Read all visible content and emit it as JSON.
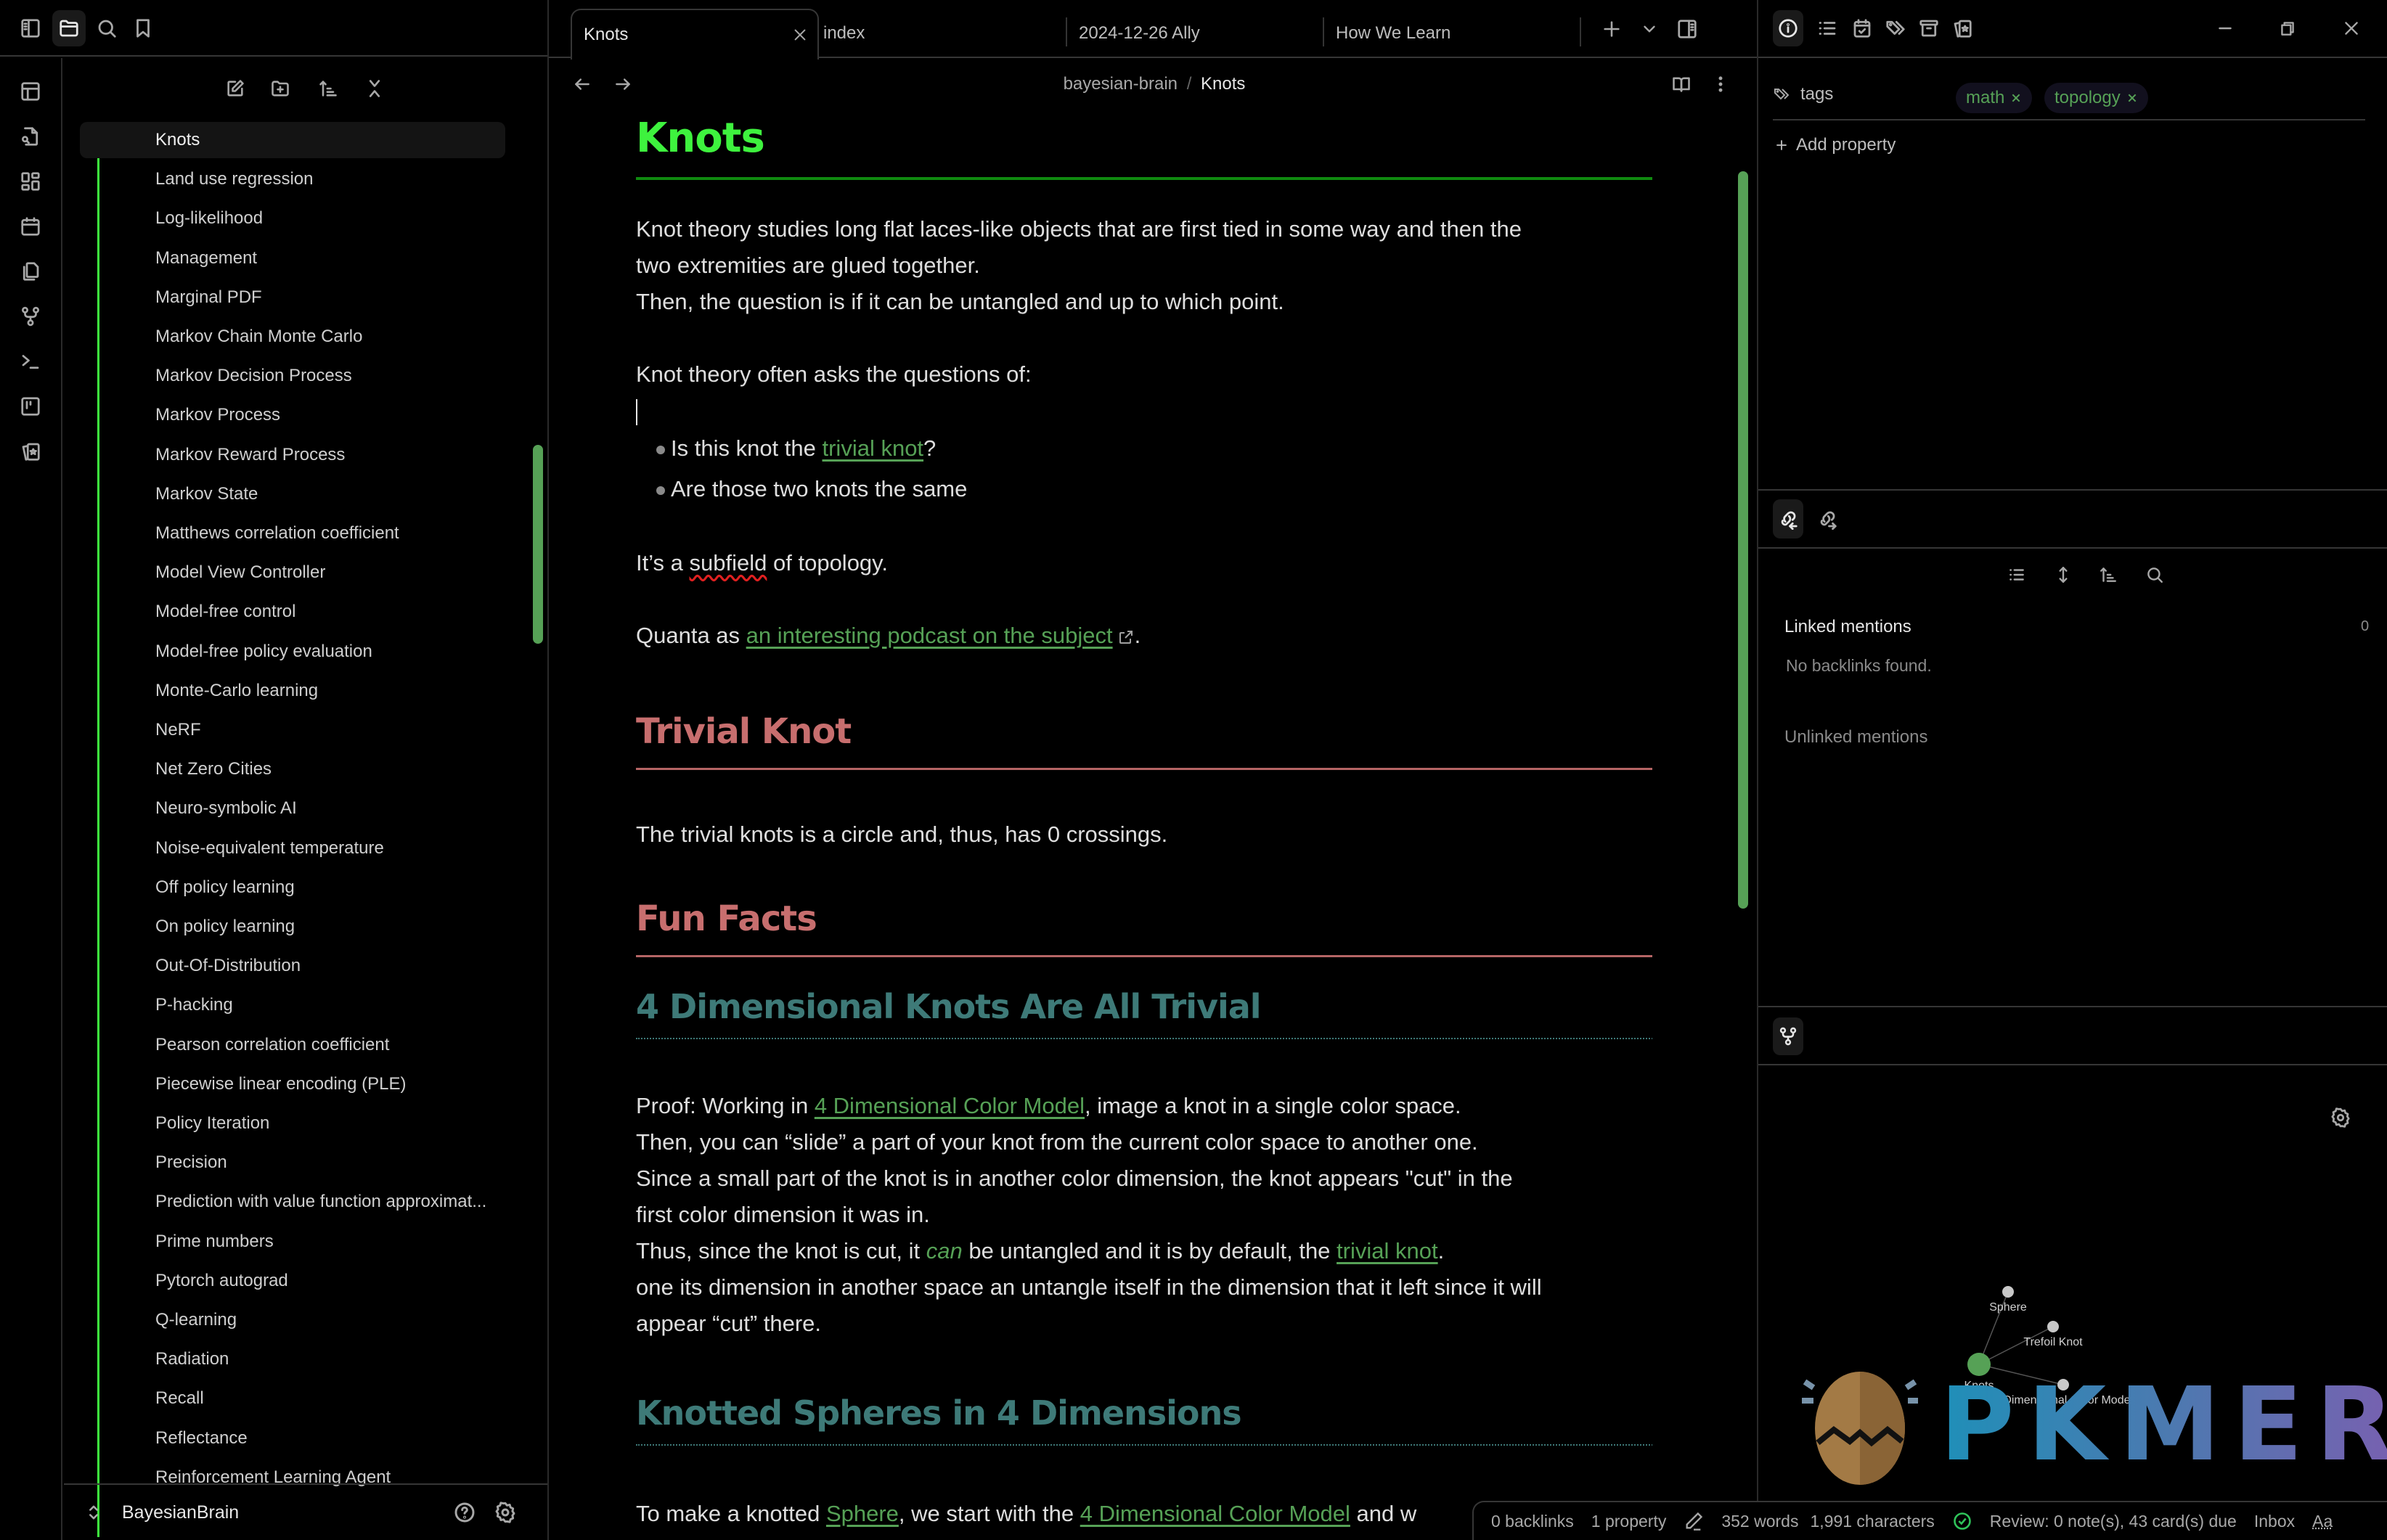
{
  "app": {
    "vault_name": "BayesianBrain",
    "accent_color": "#56a156"
  },
  "left_header": {
    "icons": [
      "sidebar-toggle-icon",
      "folder-icon",
      "search-icon",
      "bookmark-icon"
    ],
    "active": "folder-icon"
  },
  "ribbon": {
    "icons": [
      "layout-icon",
      "file-search-icon",
      "dashboard-icon",
      "calendar-icon",
      "copy-icon",
      "graph-icon",
      "terminal-icon",
      "kanban-icon",
      "flashcards-icon"
    ]
  },
  "explorer": {
    "toolbar": [
      "new-note-icon",
      "new-folder-icon",
      "sort-icon",
      "collapse-all-icon"
    ],
    "items": [
      "Knots",
      "Land use regression",
      "Log-likelihood",
      "Management",
      "Marginal PDF",
      "Markov Chain Monte Carlo",
      "Markov Decision Process",
      "Markov Process",
      "Markov Reward Process",
      "Markov State",
      "Matthews correlation coefficient",
      "Model View Controller",
      "Model-free control",
      "Model-free policy evaluation",
      "Monte-Carlo learning",
      "NeRF",
      "Net Zero Cities",
      "Neuro-symbolic AI",
      "Noise-equivalent temperature",
      "Off policy learning",
      "On policy learning",
      "Out-Of-Distribution",
      "P-hacking",
      "Pearson correlation coefficient",
      "Piecewise linear encoding (PLE)",
      "Policy Iteration",
      "Precision",
      "Prediction with value function approximat...",
      "Prime numbers",
      "Pytorch autograd",
      "Q-learning",
      "Radiation",
      "Recall",
      "Reflectance",
      "Reinforcement Learning Agent"
    ],
    "active_index": 0
  },
  "tabs": [
    {
      "label": "Knots",
      "active": true
    },
    {
      "label": "index",
      "active": false
    },
    {
      "label": "2024-12-26 Ally",
      "active": false
    },
    {
      "label": "How We Learn",
      "active": false
    }
  ],
  "breadcrumb": {
    "folder": "bayesian-brain",
    "separator": "/",
    "current": "Knots"
  },
  "note": {
    "title": "Knots",
    "intro_line1": "Knot theory studies long flat laces-like objects that are first tied in some way and then the",
    "intro_line2": "two extremities are glued together.",
    "intro_line3": "Then, the question is if it can be untangled and up to which point.",
    "questions_intro": "Knot theory often asks the questions of:",
    "bullet1_pre": "Is this knot the ",
    "bullet1_link": "trivial knot",
    "bullet1_post": "?",
    "bullet2": "Are those two knots the same",
    "subfield_pre": "It’s a ",
    "subfield_word": "subfield",
    "subfield_post": " of topology.",
    "quanta_pre": "Quanta as ",
    "quanta_link": "an interesting podcast on the subject",
    "quanta_post": ".",
    "h_trivial": "Trivial Knot",
    "trivial_text": "The trivial knots is a circle and, thus, has 0 crossings.",
    "h_fun": "Fun Facts",
    "h_4d": "4 Dimensional Knots Are All Trivial",
    "proof_pre": "Proof: Working in ",
    "proof_link": "4 Dimensional Color Model",
    "proof_post": ", image a knot in a single color space.",
    "slide_line": "Then, you can “slide” a part of your knot from the current color space to another one.",
    "since_line1": "Since a small part of the knot is in another color dimension, the knot appears \"cut\" in the",
    "since_line2": "first color dimension it was in.",
    "thus_pre": "Thus, since the knot is cut, it ",
    "thus_em": "can",
    "thus_mid": " be untangled and it is by default, the ",
    "thus_link": "trivial knot",
    "thus_post": ".",
    "one_line1": "one its dimension in another space an untangle itself in the dimension that it left since it will",
    "one_line2": "appear “cut” there.",
    "h_spheres": "Knotted Spheres in 4 Dimensions",
    "make_pre": "To make a knotted ",
    "make_link1": "Sphere",
    "make_mid": ", we start with the ",
    "make_link2": "4 Dimensional Color Model",
    "make_post": " and w"
  },
  "right_header": {
    "icons": [
      "info-icon",
      "outline-icon",
      "calendar-check-icon",
      "tags-icon",
      "archive-icon",
      "flashcards-icon"
    ],
    "active": "info-icon"
  },
  "window_controls": [
    "minimize-icon",
    "restore-icon",
    "close-icon"
  ],
  "properties": {
    "key": "tags",
    "tags": [
      "math",
      "topology"
    ],
    "add_label": "Add property"
  },
  "backlinks": {
    "tabs": [
      "backlinks-in-icon",
      "outgoing-links-icon"
    ],
    "linked_label": "Linked mentions",
    "linked_count": "0",
    "empty_text": "No backlinks found.",
    "unlinked_label": "Unlinked mentions"
  },
  "graph": {
    "nodes": [
      {
        "id": "Knots",
        "label": "Knots",
        "current": true
      },
      {
        "id": "Sphere",
        "label": "Sphere",
        "current": false
      },
      {
        "id": "Trefoil Knot",
        "label": "Trefoil Knot",
        "current": false
      },
      {
        "id": "4 Dimensional Color Model",
        "label": "4 Dimensional Color Model",
        "current": false
      }
    ],
    "edges": [
      [
        "Knots",
        "Sphere"
      ],
      [
        "Knots",
        "Trefoil Knot"
      ],
      [
        "Knots",
        "4 Dimensional Color Model"
      ]
    ],
    "watermark": "PKMER"
  },
  "status": {
    "backlinks": "0 backlinks",
    "properties": "1 property",
    "words": "352 words",
    "characters": "1,991 characters",
    "review": "Review: 0 note(s), 43 card(s) due",
    "inbox": "Inbox",
    "font": "Aa"
  }
}
